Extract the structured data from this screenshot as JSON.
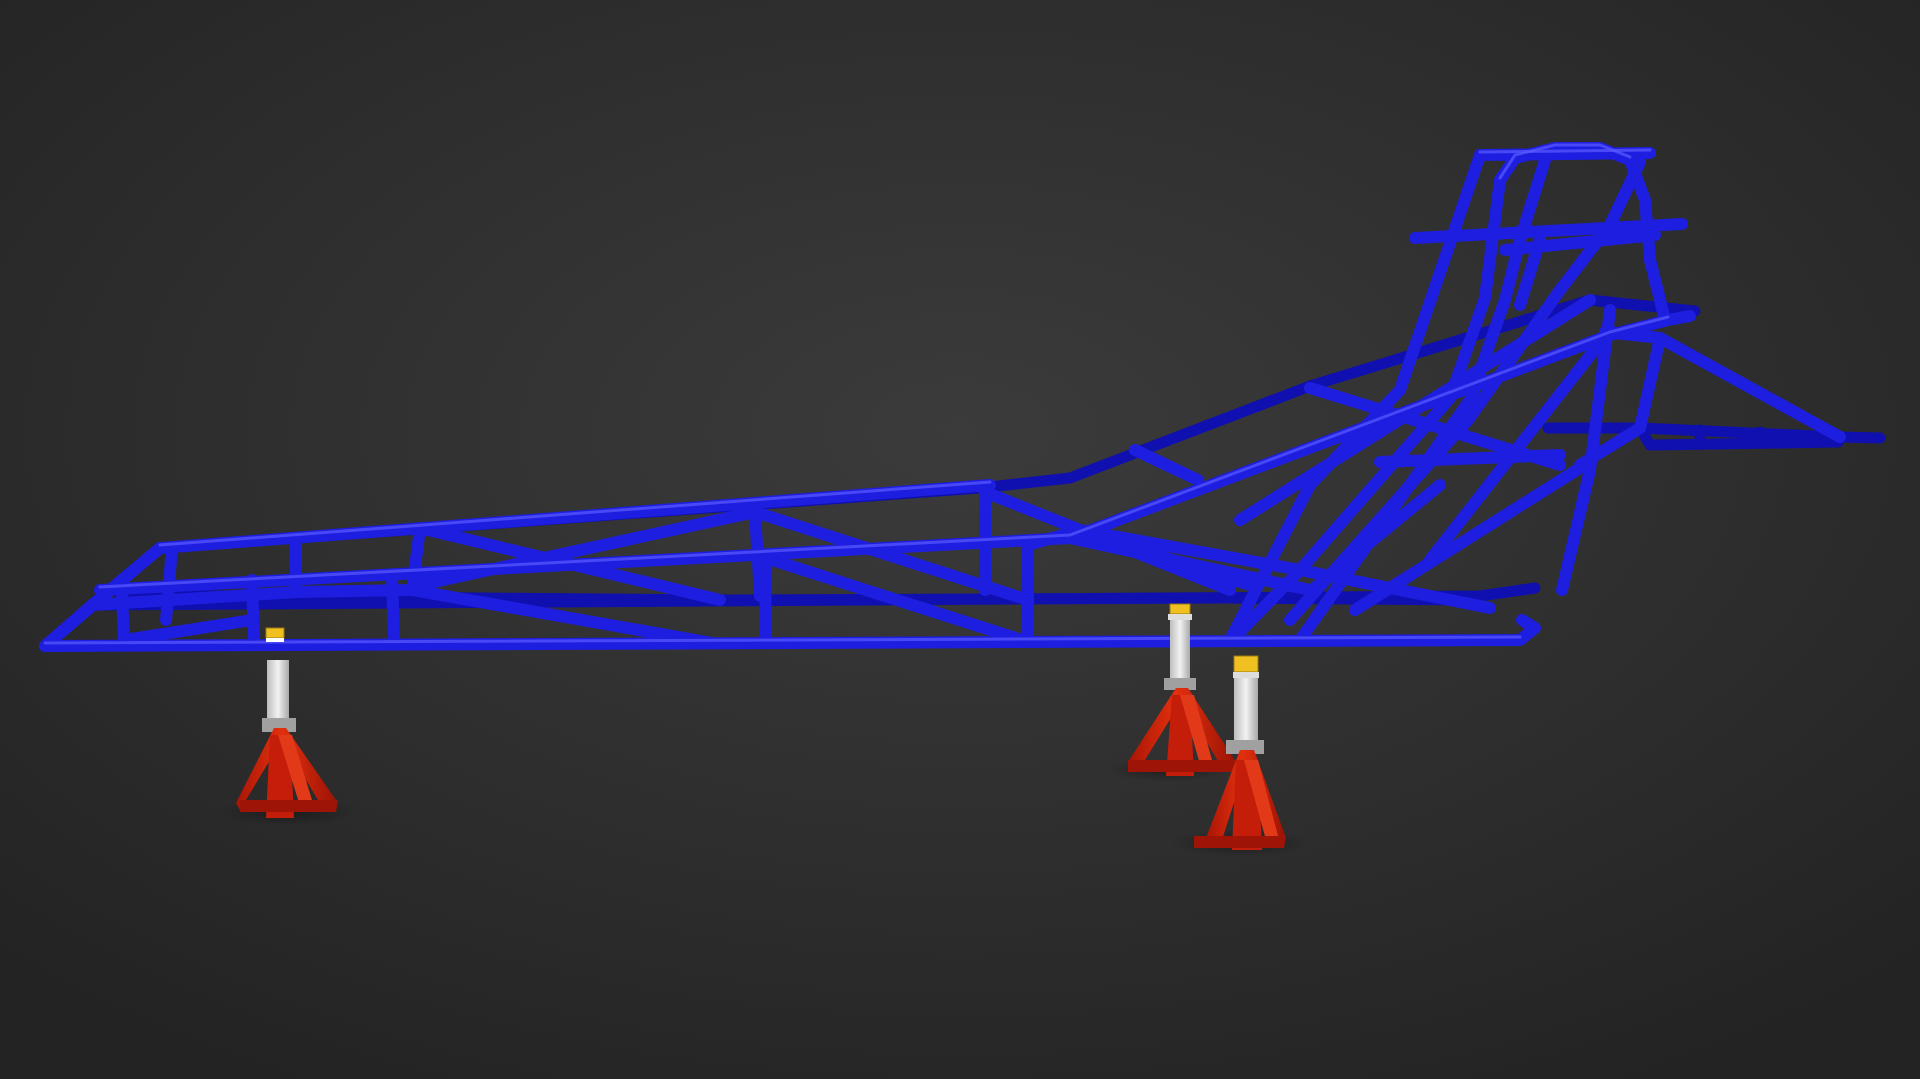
{
  "scene": {
    "background_color": "#2c2c2c",
    "frame_color": "#1a1ad8",
    "frame_highlight_color": "#4a4aff",
    "jack_base_color": "#d8220e",
    "jack_post_color": "#e8e8e8",
    "jack_saddle_color": "#f0c020",
    "stands": [
      {
        "name": "front-left-jack-stand"
      },
      {
        "name": "rear-left-jack-stand"
      },
      {
        "name": "rear-right-jack-stand"
      }
    ]
  }
}
